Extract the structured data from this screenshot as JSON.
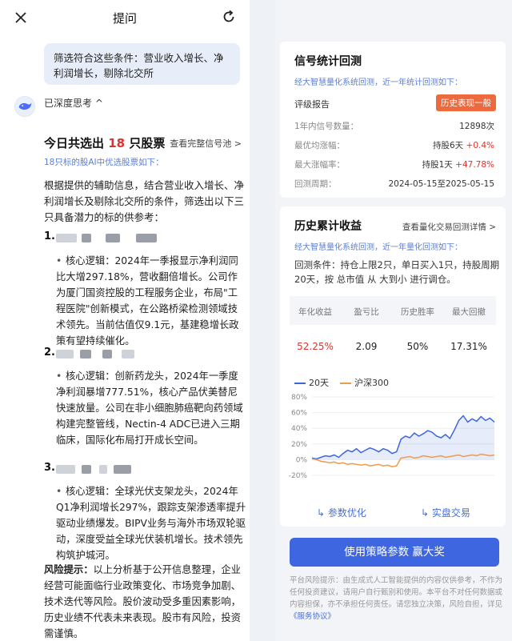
{
  "left": {
    "title": "提问",
    "query": "筛选符合这些条件：营业收入增长、净利润增长，剔除北交所",
    "think_label": "已深度思考 ^",
    "result_prefix": "今日共选出",
    "result_count": "18",
    "result_suffix": "只股票",
    "result_link": "查看完整信号池 >",
    "sub_note": "18只标的股AI中优选股票如下：",
    "intro": "根据提供的辅助信息，结合营业收入增长、净利润增长及剔除北交所的条件，筛选出以下三只具备潜力的标的供参考：",
    "items": [
      {
        "num": "1.",
        "text": "核心逻辑：2024年一季报显示净利润同比大增297.18%，营收翻倍增长。公司作为厦门国资控股的工程服务企业，布局\"工程医院\"创新模式，在公路桥梁检测领域技术领先。当前估值仅9.1元，基建稳增长政策有望持续催化。"
      },
      {
        "num": "2.",
        "text": "核心逻辑：创新药龙头，2024年一季度净利润暴增777.51%，核心产品伏美替尼快速放量。公司在非小细胞肺癌靶向药领域构建完整管线，Nectin-4 ADC已进入三期临床，国际化布局打开成长空间。"
      },
      {
        "num": "3.",
        "text": "核心逻辑：全球光伏支架龙头，2024年Q1净利润增长297%，跟踪支架渗透率提升驱动业绩爆发。BIPV业务与海外市场双轮驱动，深度受益全球光伏装机增长。技术领先构筑护城河。"
      }
    ],
    "risk_label": "风险提示：",
    "risk_text": "以上分析基于公开信息整理，企业经营可能面临行业政策变化、市场竞争加剧、技术迭代等风险。股价波动受多重因素影响，历史业绩不代表未来表现。股市有风险，投资需谨慎。"
  },
  "signal": {
    "title": "信号统计回测",
    "sub": "经大智慧量化系统回测，近一年统计回测如下：",
    "rating_label": "评级报告",
    "rating_badge": "历史表现一般",
    "rows": [
      {
        "label": "1年内信号数量：",
        "value": "12898次",
        "up": ""
      },
      {
        "label": "最优均涨幅：",
        "value": "持股6天",
        "up": "+0.4%"
      },
      {
        "label": "最大涨幅率：",
        "value": "持股1天",
        "up": "+47.78%"
      },
      {
        "label": "回测周期：",
        "value": "2024-05-15至2025-05-15",
        "up": ""
      }
    ]
  },
  "history": {
    "title": "历史累计收益",
    "link": "查看量化交易回测详情 >",
    "sub": "经大智慧量化系统回测，近一年量化回测如下：",
    "conditions": "回测条件：持仓上限2只，单日买入1只，持股周期20天，按 总市值 从 大到小 进行调仓。",
    "headers": [
      "年化收益",
      "盈亏比",
      "历史胜率",
      "最大回撤"
    ],
    "values": [
      "52.25%",
      "2.09",
      "50%",
      "17.31%"
    ],
    "legend_a": "20天",
    "legend_b": "沪深300",
    "btn_opt": "参数优化",
    "btn_live": "实盘交易"
  },
  "cta": "使用策略参数 赢大奖",
  "disclaimer_prefix": "平台风险提示：由生成式人工智能提供的内容仅供参考，不作为任何投资建议，请用户自行甄别和使用。本平台不对任何数据或内容担保，亦不承担任何责任。请您独立决策，风险自担，详见",
  "disclaimer_link": "《服务协议》",
  "chart_data": {
    "type": "line",
    "ylim": [
      -20,
      80
    ],
    "yticks": [
      "80%",
      "60%",
      "40%",
      "20%",
      "0%",
      "-20%"
    ],
    "series": [
      {
        "name": "20天",
        "color": "#3d66e0",
        "values": [
          2,
          1,
          3,
          5,
          4,
          6,
          3,
          8,
          12,
          10,
          14,
          9,
          12,
          15,
          13,
          10,
          14,
          12,
          8,
          10,
          26,
          30,
          28,
          34,
          30,
          33,
          37,
          35,
          30,
          28,
          32,
          27,
          38,
          50,
          56,
          48,
          52,
          49,
          55,
          50,
          53,
          48
        ]
      },
      {
        "name": "沪深300",
        "color": "#f09a4a",
        "values": [
          1,
          0,
          -2,
          -3,
          -4,
          -3,
          -5,
          -4,
          -6,
          -5,
          -6,
          -7,
          -6,
          -8,
          -7,
          -6,
          -8,
          -7,
          -9,
          -8,
          2,
          3,
          4,
          2,
          3,
          5,
          4,
          3,
          4,
          5,
          3,
          4,
          5,
          6,
          4,
          5,
          6,
          5,
          7,
          6,
          5,
          6
        ]
      }
    ]
  }
}
